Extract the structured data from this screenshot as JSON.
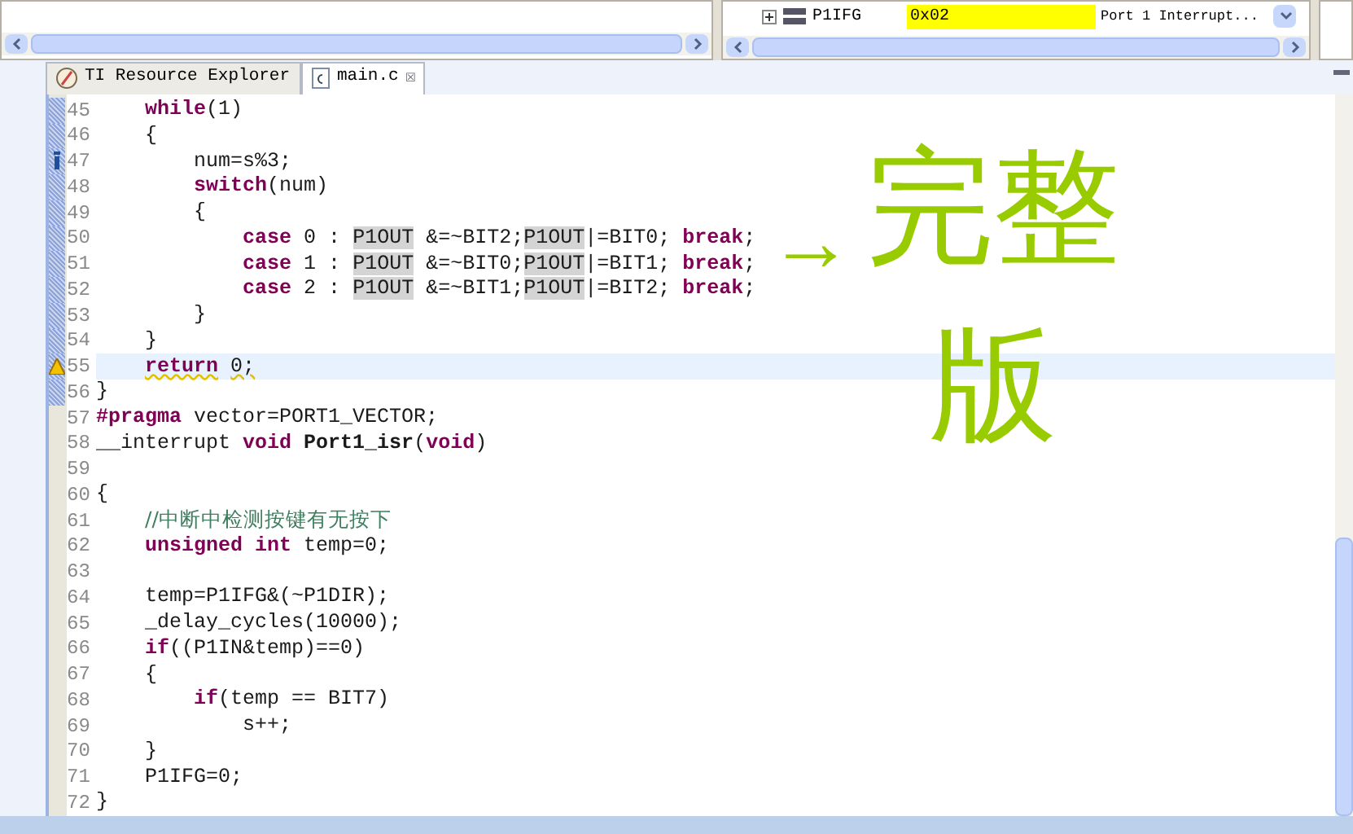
{
  "register_row": {
    "name": "P1IFG",
    "value": "0x02",
    "description": "Port 1 Interrupt..."
  },
  "tabs": [
    {
      "label": "TI Resource Explorer",
      "kind": "explorer",
      "selected": false
    },
    {
      "label": "main.c",
      "kind": "file",
      "selected": true
    }
  ],
  "close_glyph": "☒",
  "lines": [
    {
      "number": "45",
      "changed": true,
      "current": false,
      "kind": "plain",
      "segments": [
        {
          "kind": "kw",
          "text": "    while"
        },
        {
          "kind": "plain",
          "text": "(1)"
        }
      ]
    },
    {
      "number": "46",
      "changed": true,
      "current": false,
      "kind": "plain",
      "segments": [
        {
          "kind": "plain",
          "text": "    {"
        }
      ]
    },
    {
      "number": "47",
      "changed": true,
      "current": false,
      "kind": "info",
      "segments": [
        {
          "kind": "plain",
          "text": "        num=s%3;"
        }
      ]
    },
    {
      "number": "48",
      "changed": true,
      "current": false,
      "kind": "plain",
      "segments": [
        {
          "kind": "kw",
          "text": "        switch"
        },
        {
          "kind": "plain",
          "text": "(num)"
        }
      ]
    },
    {
      "number": "49",
      "changed": true,
      "current": false,
      "kind": "plain",
      "segments": [
        {
          "kind": "plain",
          "text": "        {"
        }
      ]
    },
    {
      "number": "50",
      "changed": true,
      "current": false,
      "kind": "plain",
      "segments": [
        {
          "kind": "kw",
          "text": "            case"
        },
        {
          "kind": "plain",
          "text": " 0 : "
        },
        {
          "kind": "hl",
          "text": "P1OUT"
        },
        {
          "kind": "plain",
          "text": " &=~BIT2;"
        },
        {
          "kind": "hl",
          "text": "P1OUT"
        },
        {
          "kind": "plain",
          "text": "|=BIT0; "
        },
        {
          "kind": "kw",
          "text": "break"
        },
        {
          "kind": "plain",
          "text": ";"
        }
      ]
    },
    {
      "number": "51",
      "changed": true,
      "current": false,
      "kind": "plain",
      "segments": [
        {
          "kind": "kw",
          "text": "            case"
        },
        {
          "kind": "plain",
          "text": " 1 : "
        },
        {
          "kind": "hl",
          "text": "P1OUT"
        },
        {
          "kind": "plain",
          "text": " &=~BIT0;"
        },
        {
          "kind": "hl",
          "text": "P1OUT"
        },
        {
          "kind": "plain",
          "text": "|=BIT1; "
        },
        {
          "kind": "kw",
          "text": "break"
        },
        {
          "kind": "plain",
          "text": ";"
        }
      ]
    },
    {
      "number": "52",
      "changed": true,
      "current": false,
      "kind": "plain",
      "segments": [
        {
          "kind": "kw",
          "text": "            case"
        },
        {
          "kind": "plain",
          "text": " 2 : "
        },
        {
          "kind": "hl",
          "text": "P1OUT"
        },
        {
          "kind": "plain",
          "text": " &=~BIT1;"
        },
        {
          "kind": "hl",
          "text": "P1OUT"
        },
        {
          "kind": "plain",
          "text": "|=BIT2; "
        },
        {
          "kind": "kw",
          "text": "break"
        },
        {
          "kind": "plain",
          "text": ";"
        }
      ]
    },
    {
      "number": "53",
      "changed": true,
      "current": false,
      "kind": "plain",
      "segments": [
        {
          "kind": "plain",
          "text": "        }"
        }
      ]
    },
    {
      "number": "54",
      "changed": true,
      "current": false,
      "kind": "plain",
      "segments": [
        {
          "kind": "plain",
          "text": "    }"
        }
      ]
    },
    {
      "number": "55",
      "changed": true,
      "current": true,
      "kind": "warning",
      "segments": [
        {
          "kind": "kw_warn",
          "text": "    return"
        },
        {
          "kind": "warn",
          "text": " 0;"
        }
      ]
    },
    {
      "number": "56",
      "changed": true,
      "current": false,
      "kind": "plain",
      "segments": [
        {
          "kind": "plain",
          "text": "}"
        }
      ]
    },
    {
      "number": "57",
      "changed": false,
      "current": false,
      "kind": "plain",
      "segments": [
        {
          "kind": "kw",
          "text": "#pragma"
        },
        {
          "kind": "plain",
          "text": " vector=PORT1_VECTOR;"
        }
      ]
    },
    {
      "number": "58",
      "changed": false,
      "current": false,
      "kind": "plain",
      "segments": [
        {
          "kind": "plain",
          "text": "__interrupt "
        },
        {
          "kind": "kw",
          "text": "void"
        },
        {
          "kind": "bold",
          "text": " Port1_isr"
        },
        {
          "kind": "plain",
          "text": "("
        },
        {
          "kind": "kw",
          "text": "void"
        },
        {
          "kind": "plain",
          "text": ")"
        }
      ]
    },
    {
      "number": "59",
      "changed": false,
      "current": false,
      "kind": "plain"
    },
    {
      "number": "60",
      "changed": false,
      "current": false,
      "kind": "plain",
      "segments": [
        {
          "kind": "plain",
          "text": "{"
        }
      ]
    },
    {
      "number": "61",
      "changed": false,
      "current": false,
      "kind": "plain",
      "segments": [
        {
          "kind": "comment",
          "text": "    //中断中检测按键有无按下"
        }
      ]
    },
    {
      "number": "62",
      "changed": false,
      "current": false,
      "kind": "plain",
      "segments": [
        {
          "kind": "kw",
          "text": "    unsigned int"
        },
        {
          "kind": "plain",
          "text": " temp=0;"
        }
      ]
    },
    {
      "number": "63",
      "changed": false,
      "current": false,
      "kind": "plain"
    },
    {
      "number": "64",
      "changed": false,
      "current": false,
      "kind": "plain",
      "segments": [
        {
          "kind": "plain",
          "text": "    temp=P1IFG&(~P1DIR);"
        }
      ]
    },
    {
      "number": "65",
      "changed": false,
      "current": false,
      "kind": "plain",
      "segments": [
        {
          "kind": "plain",
          "text": "    _delay_cycles(10000);"
        }
      ]
    },
    {
      "number": "66",
      "changed": false,
      "current": false,
      "kind": "plain",
      "segments": [
        {
          "kind": "kw",
          "text": "    if"
        },
        {
          "kind": "plain",
          "text": "((P1IN&temp)==0)"
        }
      ]
    },
    {
      "number": "67",
      "changed": false,
      "current": false,
      "kind": "plain",
      "segments": [
        {
          "kind": "plain",
          "text": "    {"
        }
      ]
    },
    {
      "number": "68",
      "changed": false,
      "current": false,
      "kind": "plain",
      "segments": [
        {
          "kind": "kw",
          "text": "        if"
        },
        {
          "kind": "plain",
          "text": "(temp == BIT7)"
        }
      ]
    },
    {
      "number": "69",
      "changed": false,
      "current": false,
      "kind": "plain",
      "segments": [
        {
          "kind": "plain",
          "text": "            s++;"
        }
      ]
    },
    {
      "number": "70",
      "changed": false,
      "current": false,
      "kind": "plain",
      "segments": [
        {
          "kind": "plain",
          "text": "    }"
        }
      ]
    },
    {
      "number": "71",
      "changed": false,
      "current": false,
      "kind": "plain",
      "segments": [
        {
          "kind": "plain",
          "text": "    P1IFG=0;"
        }
      ]
    },
    {
      "number": "72",
      "changed": false,
      "current": false,
      "kind": "plain",
      "segments": [
        {
          "kind": "plain",
          "text": "}"
        }
      ]
    }
  ],
  "annotation": {
    "arrow": "→",
    "text": "完整版"
  }
}
